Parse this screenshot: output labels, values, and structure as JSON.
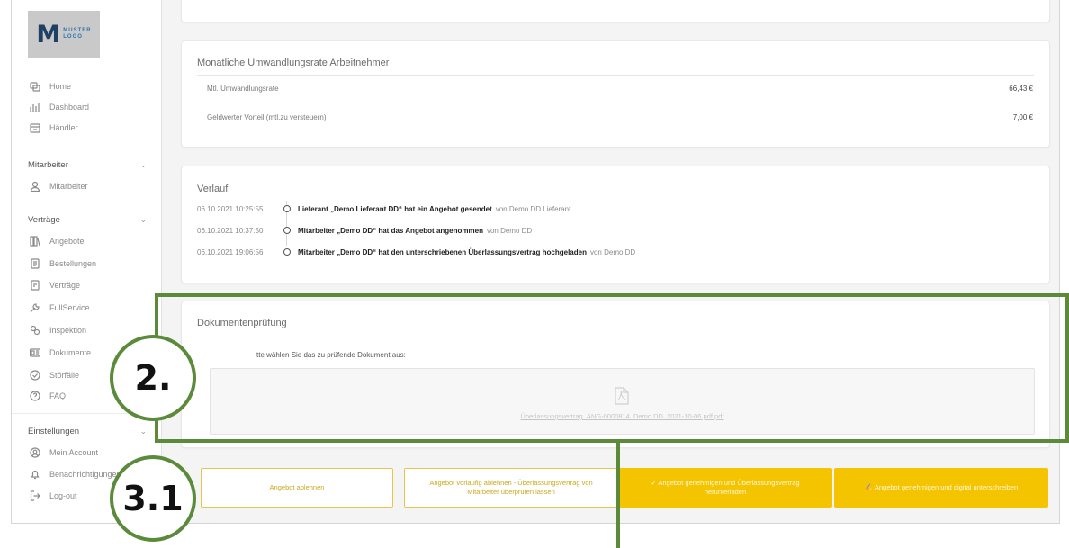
{
  "logo": {
    "mark": "M",
    "line1": "MUSTER",
    "line2": "LOGO"
  },
  "nav": {
    "top": [
      {
        "label": "Home",
        "icon": "home-icon"
      },
      {
        "label": "Dashboard",
        "icon": "dashboard-icon"
      },
      {
        "label": "Händler",
        "icon": "store-icon"
      }
    ],
    "sections": [
      {
        "title": "Mitarbeiter",
        "items": [
          {
            "label": "Mitarbeiter",
            "icon": "user-icon"
          }
        ]
      },
      {
        "title": "Verträge",
        "items": [
          {
            "label": "Angebote",
            "icon": "offers-icon"
          },
          {
            "label": "Bestellungen",
            "icon": "orders-icon"
          },
          {
            "label": "Verträge",
            "icon": "contract-icon"
          },
          {
            "label": "FullService",
            "icon": "wrench-icon"
          },
          {
            "label": "Inspektion",
            "icon": "inspection-icon"
          },
          {
            "label": "Dokumente",
            "icon": "document-icon"
          },
          {
            "label": "Störfälle",
            "icon": "check-circle-icon"
          },
          {
            "label": "FAQ",
            "icon": "help-icon"
          }
        ]
      },
      {
        "title": "Einstellungen",
        "items": [
          {
            "label": "Mein Account",
            "icon": "account-icon"
          },
          {
            "label": "Benachrichtigungen",
            "icon": "bell-icon"
          },
          {
            "label": "Log-out",
            "icon": "logout-icon"
          }
        ]
      }
    ]
  },
  "conversion": {
    "title": "Monatliche Umwandlungsrate Arbeitnehmer",
    "rows": [
      {
        "label": "Mtl. Umwandlungsrate",
        "value": "66,43 €"
      },
      {
        "label": "Geldwerter Vorteil (mtl.zu versteuern)",
        "value": "7,00 €"
      }
    ]
  },
  "history": {
    "title": "Verlauf",
    "entries": [
      {
        "time": "06.10.2021 10:25:55",
        "text": "Lieferant „Demo Lieferant DD“ hat ein Angebot gesendet",
        "by": "von Demo DD Lieferant"
      },
      {
        "time": "06.10.2021 10:37:50",
        "text": "Mitarbeiter „Demo DD“ hat das Angebot angenommen",
        "by": "von Demo DD"
      },
      {
        "time": "06.10.2021 19:06:56",
        "text": "Mitarbeiter „Demo DD“ hat den unterschriebenen Überlassungsvertrag hochgeladen",
        "by": "von Demo DD"
      }
    ]
  },
  "documents": {
    "title": "Dokumentenprüfung",
    "instruction": "tte wählen Sie das zu prüfende Dokument aus:",
    "file": "Überlassungsvertrag_ANG-0000814_Demo DD_2021-10-06.pdf.pdf"
  },
  "actions": {
    "reject": "Angebot ablehnen",
    "reject_tmp": "Angebot vorläufig ablehnen - Überlassungsvertrag von Mitarbeiter überprüfen lassen",
    "approve_download": "✓ Angebot genehmigen und Überlassungsvertrag herunterladen",
    "approve_sign": "✍ Angebot genehmigen und digital unterschreiben"
  },
  "annotations": {
    "label_2": "2.",
    "label_31": "3.1",
    "color": "#5a8a3a"
  },
  "colors": {
    "accent": "#f5c400"
  }
}
